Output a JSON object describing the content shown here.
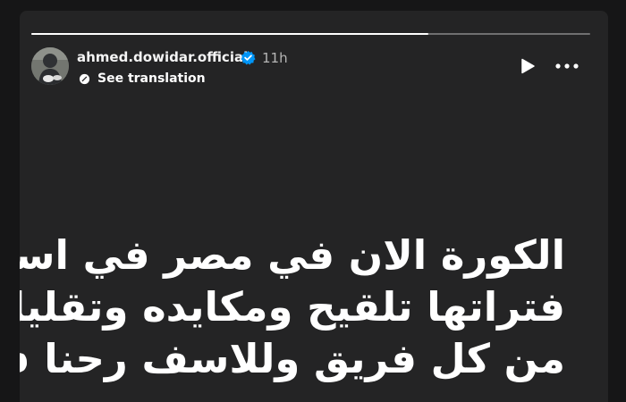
{
  "post": {
    "username": "ahmed.dowidar.official",
    "time_ago": "11h",
    "translation_label": "See translation",
    "progress_fraction": 0.71,
    "text_lines": [
      "الكورة الان في مصر في اسوء",
      "فتراتها تلقيح ومكايده وتقليل",
      "من كل فريق وللاسف رحنا في"
    ]
  },
  "icons": {
    "verified": "verified-badge-icon",
    "translate": "translate-icon",
    "play": "play-icon",
    "more": "more-options-icon"
  },
  "colors": {
    "story_background": "#242425",
    "page_background": "#161617",
    "text": "#ffffff",
    "verified": "#0095f6"
  }
}
